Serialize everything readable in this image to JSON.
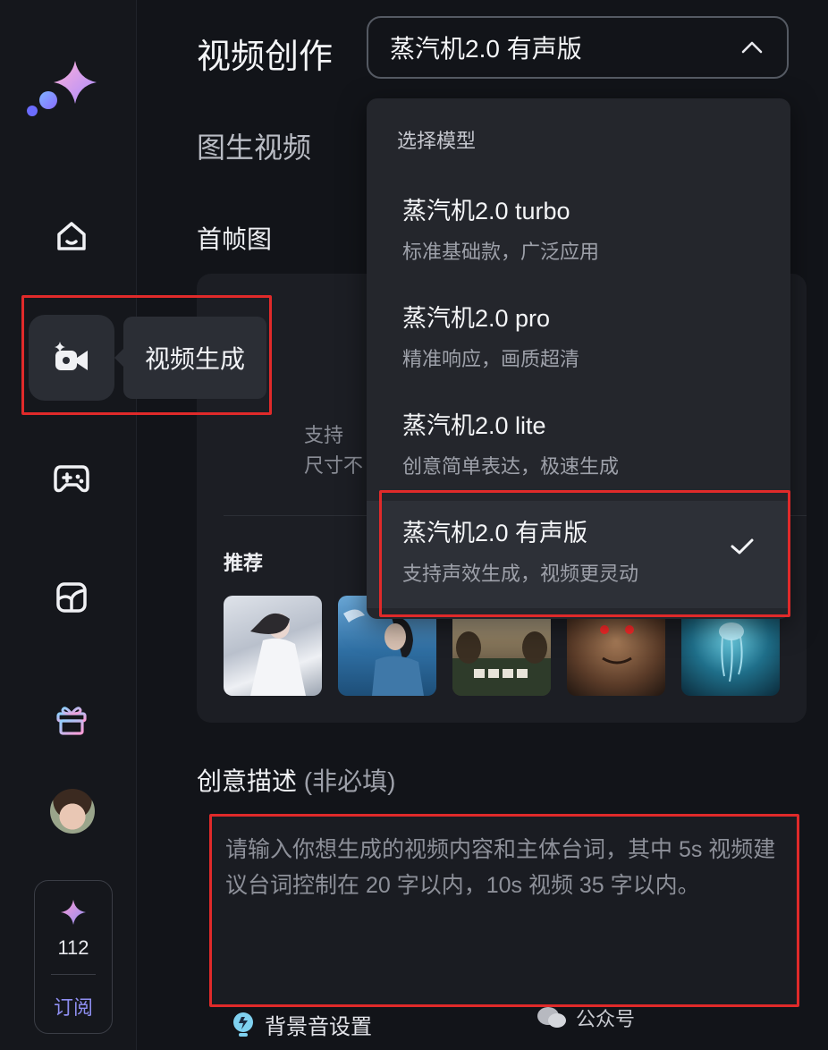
{
  "sidebar": {
    "tooltip": "视频生成",
    "credits": {
      "value": "112",
      "subscribe": "订阅"
    }
  },
  "header": {
    "title": "视频创作",
    "model_selected": "蒸汽机2.0 有声版"
  },
  "main": {
    "tab": "图生视频",
    "first_frame_label": "首帧图",
    "upload_hint_line1": "支持",
    "upload_hint_line2": "尺寸不",
    "recommend_label": "推荐",
    "description_label": "创意描述",
    "description_optional": "(非必填)",
    "description_placeholder": "请输入你想生成的视频内容和主体台词，其中 5s 视频建议台词控制在 20 字以内，10s 视频 35 字以内。",
    "bgm_label": "背景音设置"
  },
  "dropdown": {
    "header": "选择模型",
    "items": [
      {
        "name": "蒸汽机2.0 turbo",
        "desc": "标准基础款，广泛应用"
      },
      {
        "name": "蒸汽机2.0 pro",
        "desc": "精准响应，画质超清"
      },
      {
        "name": "蒸汽机2.0 lite",
        "desc": "创意简单表达，极速生成"
      },
      {
        "name": "蒸汽机2.0 有声版",
        "desc": "支持声效生成，视频更灵动"
      }
    ]
  },
  "watermark": {
    "text": "公众号"
  },
  "colors": {
    "accent": "#8e8ef0",
    "highlight": "#e02a2a"
  }
}
